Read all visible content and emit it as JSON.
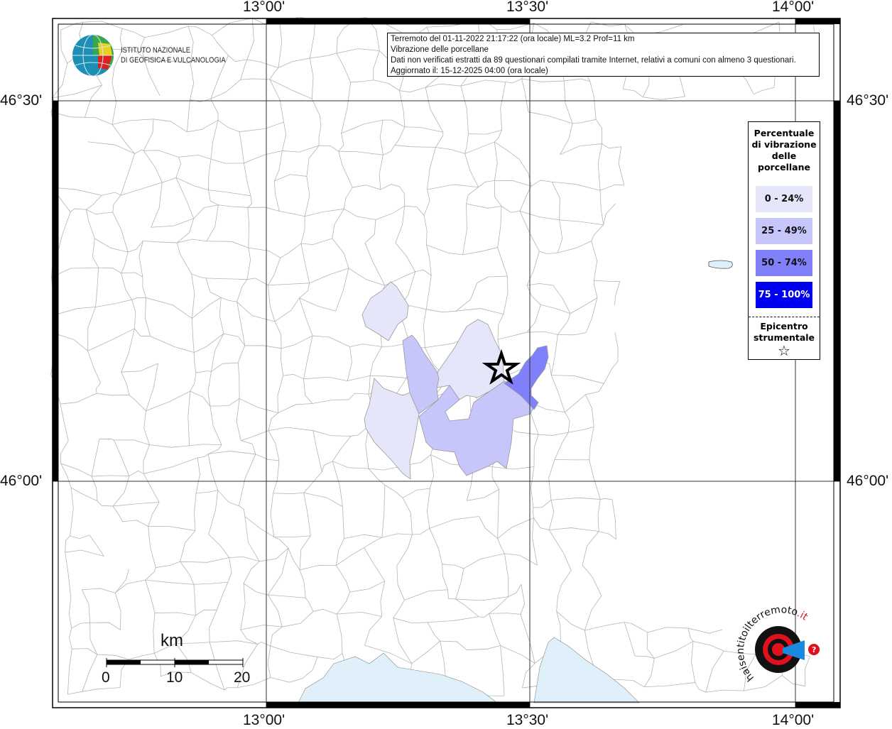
{
  "info_box": {
    "line1": "Terremoto del 01-11-2022 21:17:22 (ora locale) ML=3.2 Prof=11 km",
    "line2": "Vibrazione delle porcellane",
    "line3": "Dati non verificati estratti da 89 questionari compilati tramite Internet, relativi a comuni con almeno 3 questionari.",
    "line4": "Aggiornato il: 15-12-2025 04:00 (ora locale)"
  },
  "coords": {
    "lon": [
      "13°00'",
      "13°30'",
      "14°00'"
    ],
    "lat": [
      "46°30'",
      "46°00'"
    ]
  },
  "legend": {
    "title": [
      "Percentuale",
      "di vibrazione",
      "delle",
      "porcellane"
    ],
    "classes": [
      {
        "label": "0 - 24%",
        "color": "#e6e6fa",
        "text_color": "#111111"
      },
      {
        "label": "25 - 49%",
        "color": "#c6c6fa",
        "text_color": "#111111"
      },
      {
        "label": "50 - 74%",
        "color": "#8080fa",
        "text_color": "#111111"
      },
      {
        "label": "75 - 100%",
        "color": "#0000f0",
        "text_color": "#ffffff"
      }
    ],
    "epicenter_label": [
      "Epicentro",
      "strumentale"
    ],
    "epicenter_symbol": "☆"
  },
  "scale_bar": {
    "unit": "km",
    "ticks": [
      "0",
      "10",
      "20"
    ]
  },
  "ingv_logo": {
    "line1": "ISTITUTO NAZIONALE",
    "line2": "DI GEOFISICA E VULCANOLOGIA"
  },
  "hst_logo": {
    "text": "www.haisentitoilterremoto.it"
  },
  "colors": {
    "sea": "#dff0fb",
    "boundary": "#b4b4b4"
  }
}
